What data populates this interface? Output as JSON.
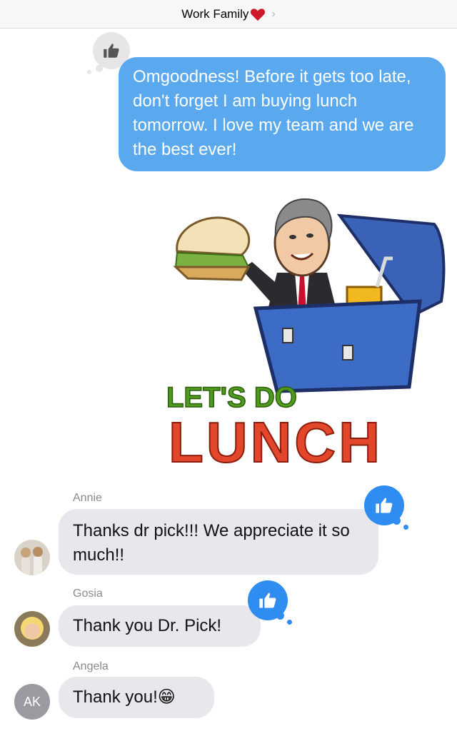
{
  "header": {
    "title": "Work Family",
    "heart_icon": "red-heart",
    "chevron_icon": "chevron-right"
  },
  "messages": {
    "outgoing": {
      "text": "Omgoodness!  Before it gets too late, don't forget I am buying lunch tomorrow. I love my team and we are the best ever!",
      "reaction_icon": "thumbs-up"
    },
    "sticker": {
      "line1": "LET'S DO",
      "line2": "LUNCH"
    },
    "incoming": [
      {
        "sender": "Annie",
        "text": "Thanks dr pick!!! We appreciate it so much!!",
        "reaction_icon": "thumbs-up"
      },
      {
        "sender": "Gosia",
        "text": "Thank you Dr. Pick!",
        "reaction_icon": "thumbs-up"
      },
      {
        "sender": "Angela",
        "text": "Thank you!😁",
        "avatar_initials": "AK"
      }
    ]
  },
  "colors": {
    "outgoing_bubble": "#5aa9ee",
    "incoming_bubble": "#e8e8ec",
    "tapback_blue": "#2f8cf0"
  }
}
